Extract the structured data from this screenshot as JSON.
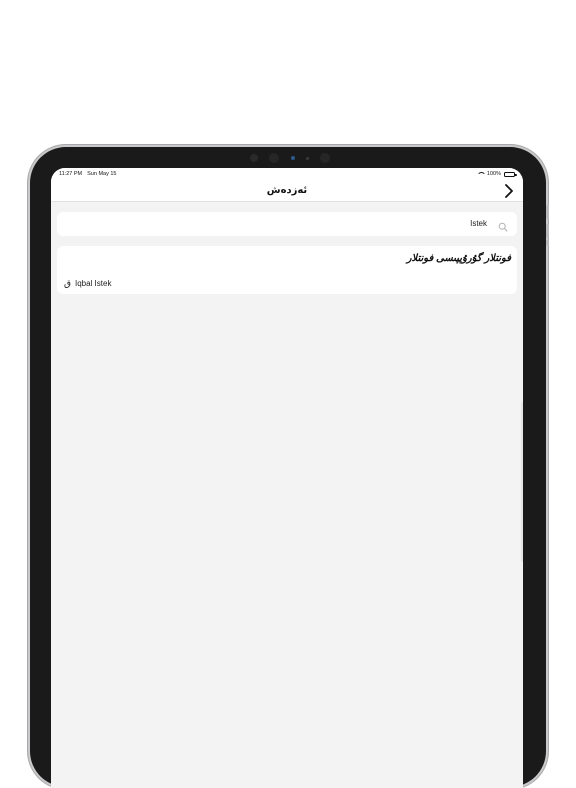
{
  "status_bar": {
    "time": "11:27 PM",
    "date": "Sun May 15",
    "battery": "100%"
  },
  "nav": {
    "title": "ئەزدەش",
    "back_icon": "chevron-right-icon"
  },
  "search": {
    "value": "Istek",
    "icon": "search-icon"
  },
  "results": {
    "section_title": "فونتلار گۇرۇپپىسى فونتلار",
    "items": [
      {
        "glyph": "ق",
        "label": "Iqbal Istek"
      }
    ]
  },
  "colors": {
    "background": "#f3f3f3",
    "card": "#ffffff",
    "text": "#111111",
    "device_frame": "#1a1a1a"
  }
}
